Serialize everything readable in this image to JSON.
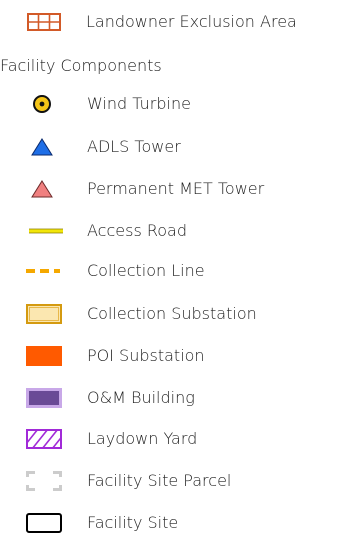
{
  "legend": {
    "heading": "Facility Components",
    "items": [
      {
        "label": "Landowner Exclusion Area",
        "icon": "landowner-exclusion-icon",
        "color": "#d25a28"
      },
      {
        "label": "Wind Turbine",
        "icon": "wind-turbine-icon",
        "color": "#f5c518"
      },
      {
        "label": "ADLS Tower",
        "icon": "adls-tower-icon",
        "color": "#1e6ee6"
      },
      {
        "label": "Permanent MET Tower",
        "icon": "met-tower-icon",
        "color": "#f08080"
      },
      {
        "label": "Access Road",
        "icon": "access-road-icon",
        "color": "#f2e60a"
      },
      {
        "label": "Collection Line",
        "icon": "collection-line-icon",
        "color": "#f5a800"
      },
      {
        "label": "Collection Substation",
        "icon": "collection-substation-icon",
        "color": "#fbe7b0"
      },
      {
        "label": "POI Substation",
        "icon": "poi-substation-icon",
        "color": "#ff5a00"
      },
      {
        "label": "O&M Building",
        "icon": "om-building-icon",
        "color": "#6a4a96"
      },
      {
        "label": "Laydown Yard",
        "icon": "laydown-yard-icon",
        "color": "#a12ad8"
      },
      {
        "label": "Facility Site Parcel",
        "icon": "facility-site-parcel-icon",
        "color": "#cccccc"
      },
      {
        "label": "Facility Site",
        "icon": "facility-site-icon",
        "color": "#000000"
      }
    ]
  }
}
